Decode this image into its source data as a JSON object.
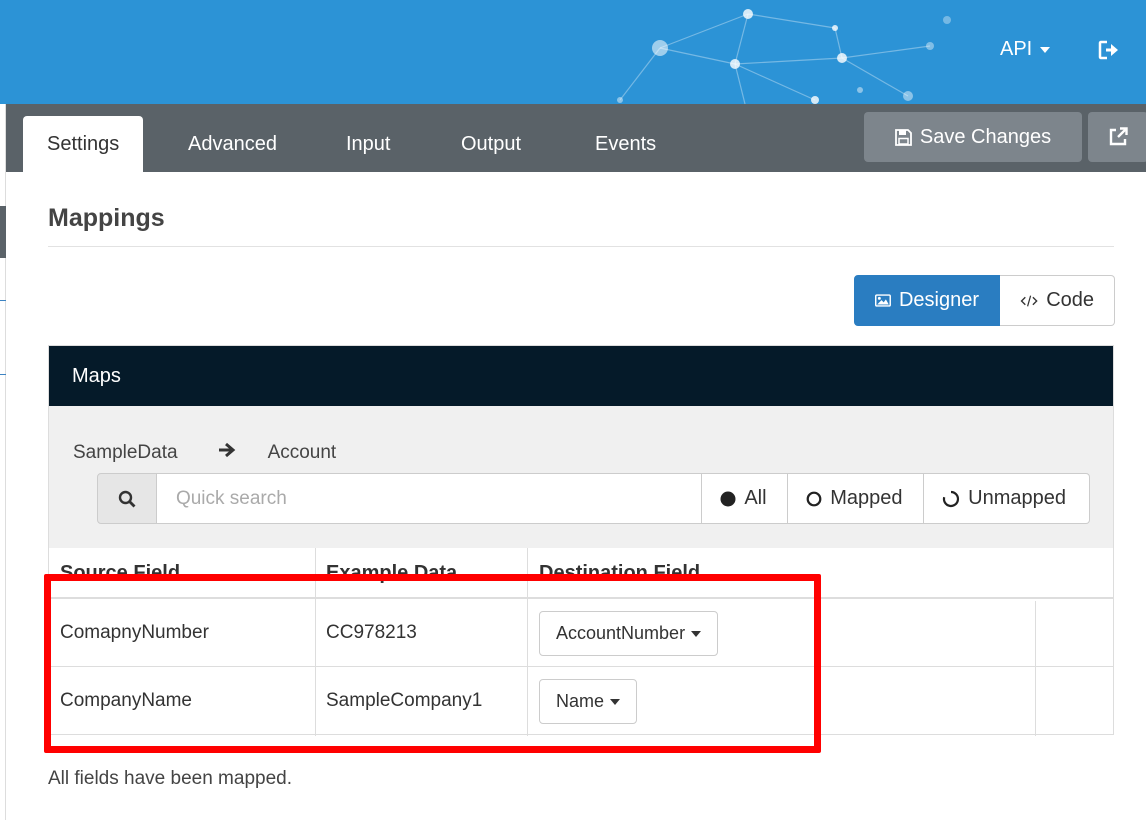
{
  "header": {
    "api_menu_label": "API"
  },
  "tabs": [
    {
      "label": "Settings"
    },
    {
      "label": "Advanced"
    },
    {
      "label": "Input"
    },
    {
      "label": "Output"
    },
    {
      "label": "Events"
    }
  ],
  "toolbar": {
    "save_label": "Save Changes"
  },
  "section": {
    "title": "Mappings"
  },
  "view_toggle": {
    "designer_label": "Designer",
    "code_label": "Code"
  },
  "maps": {
    "title": "Maps",
    "source_name": "SampleData",
    "destination_name": "Account",
    "search": {
      "placeholder": "Quick search",
      "value": ""
    },
    "filters": [
      {
        "label": "All"
      },
      {
        "label": "Mapped"
      },
      {
        "label": "Unmapped"
      }
    ],
    "columns": [
      "Source Field",
      "Example Data",
      "Destination Field"
    ],
    "rows": [
      {
        "source": "ComapnyNumber",
        "example": "CC978213",
        "destination": "AccountNumber"
      },
      {
        "source": "CompanyName",
        "example": "SampleCompany1",
        "destination": "Name"
      }
    ]
  },
  "status_text": "All fields have been mapped.",
  "colors": {
    "header_bg": "#2c93d6",
    "tabbar_bg": "#5a6268",
    "primary": "#2a7dc1",
    "panel_head": "#051a29",
    "highlight": "#ff0000"
  }
}
